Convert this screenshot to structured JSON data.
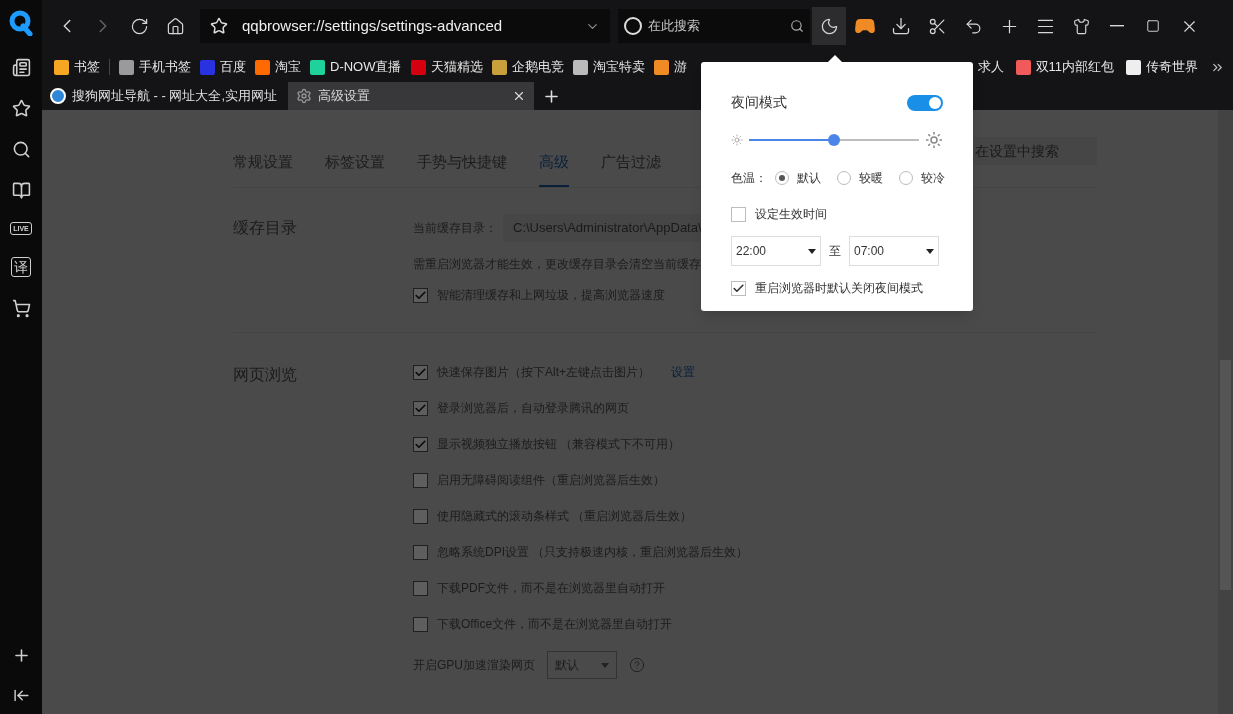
{
  "sidebar": {
    "live": "LIVE",
    "translate": "译"
  },
  "toolbar": {
    "url": "qqbrowser://settings/settings-advanced",
    "search_placeholder": "在此搜索"
  },
  "bookmarks_left": [
    {
      "label": "书签",
      "color": "#f5a623"
    },
    {
      "label": "手机书签",
      "color": "#9a9a9a"
    },
    {
      "label": "百度",
      "color": "#2932e1"
    },
    {
      "label": "淘宝",
      "color": "#ff6a00"
    },
    {
      "label": "D-NOW直播",
      "color": "#1fd19b"
    },
    {
      "label": "天猫精选",
      "color": "#d4000f"
    },
    {
      "label": "企鹅电竞",
      "color": "#c8a03c"
    },
    {
      "label": "淘宝特卖",
      "color": "#bbbbbb"
    },
    {
      "label": "游",
      "color": "#f08a24"
    }
  ],
  "bookmarks_right": [
    {
      "label": "求人"
    },
    {
      "label": "双11内部红包",
      "color": "#f05a5a"
    },
    {
      "label": "传奇世界",
      "color": "#eeeeee"
    }
  ],
  "tabs": [
    {
      "title": "搜狗网址导航 - - 网址大全,实用网址",
      "selected": false
    },
    {
      "title": "高级设置",
      "selected": true
    }
  ],
  "settings": {
    "nav": [
      {
        "label": "常规设置",
        "selected": false
      },
      {
        "label": "标签设置",
        "selected": false
      },
      {
        "label": "手势与快捷键",
        "selected": false
      },
      {
        "label": "高级",
        "selected": true
      },
      {
        "label": "广告过滤",
        "selected": false
      }
    ],
    "search_placeholder": "在设置中搜索",
    "cache": {
      "title": "缓存目录",
      "path_label": "当前缓存目录：",
      "path": "C:\\Users\\Administrator\\AppData\\",
      "note": "需重启浏览器才能生效，更改缓存目录会清空当前缓存",
      "option": {
        "label": "智能清理缓存和上网垃圾，提高浏览器速度",
        "checked": true
      }
    },
    "browsing": {
      "title": "网页浏览",
      "options": [
        {
          "label": "快速保存图片（按下Alt+左键点击图片）",
          "checked": true,
          "link": "设置"
        },
        {
          "label": "登录浏览器后，自动登录腾讯的网页",
          "checked": true
        },
        {
          "label": "显示视频独立播放按钮 （兼容模式下不可用）",
          "checked": true
        },
        {
          "label": "启用无障碍阅读组件（重启浏览器后生效）",
          "checked": false
        },
        {
          "label": "使用隐藏式的滚动条样式 （重启浏览器后生效）",
          "checked": false
        },
        {
          "label": "忽略系统DPI设置 （只支持极速内核，重启浏览器后生效）",
          "checked": false
        },
        {
          "label": "下载PDF文件，而不是在浏览器里自动打开",
          "checked": false
        },
        {
          "label": "下载Office文件，而不是在浏览器里自动打开",
          "checked": false
        }
      ],
      "gpu": {
        "label": "开启GPU加速渲染网页",
        "value": "默认"
      }
    }
  },
  "night_popup": {
    "title": "夜间模式",
    "on": true,
    "brightness": {
      "level": 0.5
    },
    "color_temp": {
      "label": "色温：",
      "options": [
        {
          "label": "默认",
          "selected": true
        },
        {
          "label": "较暖",
          "selected": false
        },
        {
          "label": "较冷",
          "selected": false
        }
      ]
    },
    "schedule": {
      "label": "设定生效时间",
      "checked": false
    },
    "from": "22:00",
    "separator": "至",
    "to": "07:00",
    "reset": {
      "label": "重启浏览器时默认关闭夜间模式",
      "checked": true
    }
  }
}
